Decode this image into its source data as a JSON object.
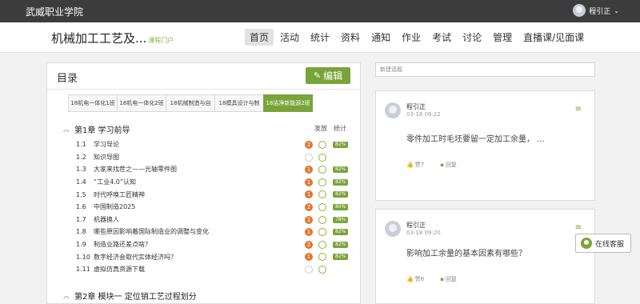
{
  "topbar": {
    "brand": "武威职业学院",
    "user": "程引正",
    "chevron": "⌄"
  },
  "header": {
    "course_title": "机械加工工艺及...",
    "portal_label": "课程门户",
    "nav": [
      {
        "label": "首页",
        "active": true
      },
      {
        "label": "活动"
      },
      {
        "label": "统计"
      },
      {
        "label": "资料"
      },
      {
        "label": "通知"
      },
      {
        "label": "作业"
      },
      {
        "label": "考试"
      },
      {
        "label": "讨论"
      },
      {
        "label": "管理"
      },
      {
        "label": "直播课/见面课"
      }
    ]
  },
  "catalog": {
    "title": "目录",
    "edit_label": "编辑",
    "tabs": [
      {
        "label": "18机电一体化1班"
      },
      {
        "label": "18机电一体化2班"
      },
      {
        "label": "18机械制造与自"
      },
      {
        "label": "18模具设计与制"
      },
      {
        "label": "18洁净新能源2班",
        "active": true
      }
    ],
    "col_publish": "发放",
    "col_stats": "统计",
    "chapter1": "第1章 学习前导",
    "chapter2": "第2章 模块一 定位销工艺过程划分",
    "lessons": [
      {
        "num": "1.1",
        "title": "学习导论",
        "badge": "2",
        "pct": "82%"
      },
      {
        "num": "1.2",
        "title": "知识导图",
        "badge": "",
        "pct": ""
      },
      {
        "num": "1.3",
        "title": "大家来找茬之——光轴零件图",
        "badge": "1",
        "pct": "82%"
      },
      {
        "num": "1.4",
        "title": "“工业4.0”认知",
        "badge": "1",
        "pct": "82%"
      },
      {
        "num": "1.5",
        "title": "时代呼唤工匠精神",
        "badge": "1",
        "pct": "82%"
      },
      {
        "num": "1.6",
        "title": "中国制造2025",
        "badge": "2",
        "pct": "80%"
      },
      {
        "num": "1.7",
        "title": "机器换人",
        "badge": "1",
        "pct": "78%"
      },
      {
        "num": "1.8",
        "title": "哪些原因影响着国际制造业的调整与变化",
        "badge": "1",
        "pct": "82%"
      },
      {
        "num": "1.9",
        "title": "制造业路还差点啥？",
        "badge": "2",
        "pct": "82%"
      },
      {
        "num": "1.10",
        "title": "数字经济会取代实体经济吗？",
        "badge": "1",
        "pct": "82%"
      },
      {
        "num": "1.11",
        "title": "虚拟仿真资源下载",
        "badge": "",
        "pct": ""
      }
    ]
  },
  "discussion": {
    "new_topic_placeholder": "新建话题",
    "posts": [
      {
        "author": "程引正",
        "time": "03-18 09:22",
        "text": "零件加工时毛坯要留一定加工余量， ...",
        "likes": "赞7",
        "reply": "回复"
      },
      {
        "author": "程引正",
        "time": "03-18 09:20",
        "text": "影响加工余量的基本因素有哪些？",
        "likes": "赞6",
        "reply": "回复"
      }
    ]
  },
  "support": {
    "label": "在线客服"
  },
  "colors": {
    "accent": "#79a43a",
    "topbar": "#3c3c3c",
    "badge": "#e8742c"
  }
}
